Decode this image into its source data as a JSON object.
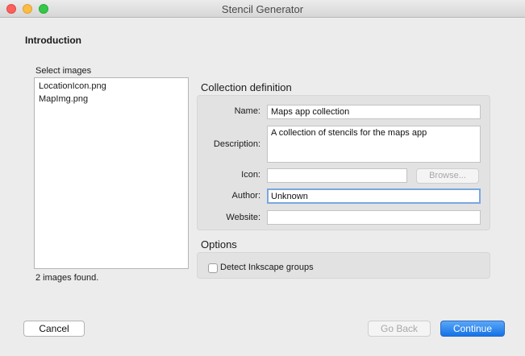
{
  "window": {
    "title": "Stencil Generator"
  },
  "page": {
    "heading": "Introduction"
  },
  "images": {
    "label": "Select images",
    "items": [
      "LocationIcon.png",
      "MapImg.png"
    ],
    "status": "2 images found."
  },
  "collection": {
    "section_title": "Collection definition",
    "name_label": "Name:",
    "name_value": "Maps app collection",
    "description_label": "Description:",
    "description_value": "A collection of stencils for the maps app",
    "icon_label": "Icon:",
    "icon_value": "",
    "browse_label": "Browse...",
    "author_label": "Author:",
    "author_value": "Unknown",
    "website_label": "Website:",
    "website_value": ""
  },
  "options": {
    "section_title": "Options",
    "detect_groups_label": "Detect Inkscape groups",
    "detect_groups_checked": false
  },
  "footer": {
    "cancel_label": "Cancel",
    "back_label": "Go Back",
    "continue_label": "Continue"
  },
  "colors": {
    "accent": "#1473e6",
    "close": "#fc605c",
    "minimize": "#fdbc40",
    "maximize": "#34c84a"
  }
}
